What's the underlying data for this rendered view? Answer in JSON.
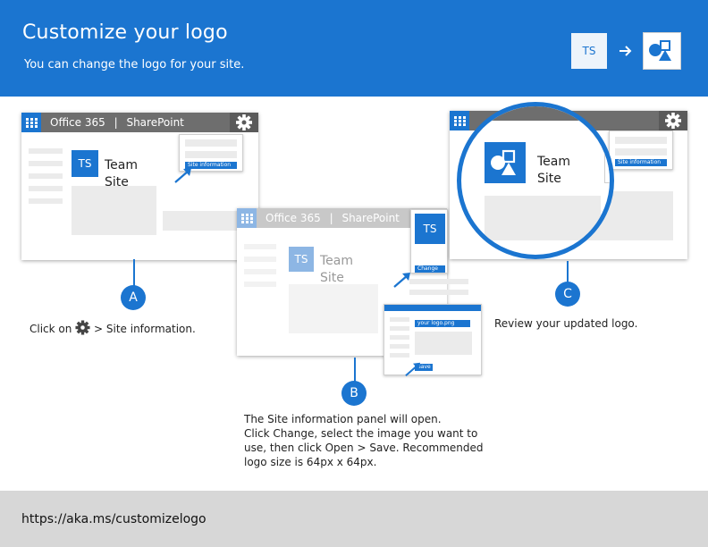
{
  "header": {
    "title": "Customize your logo",
    "subtitle": "You can change the logo for your site.",
    "initials": "TS",
    "accent": "#1b75d0"
  },
  "mock_a": {
    "bar_brand": "Office 365",
    "bar_separator": "|",
    "bar_product": "SharePoint",
    "initials": "TS",
    "site_line1": "Team",
    "site_line2": "Site",
    "panel_button": "Site information"
  },
  "mock_b": {
    "bar_brand": "Office 365",
    "bar_separator": "|",
    "bar_product": "SharePoint",
    "initials": "TS",
    "panel_initials": "TS",
    "site_line1": "Team",
    "site_line2": "Site",
    "change_button": "Change",
    "file_bar": "your logo.png",
    "save_button": "Save"
  },
  "mock_c": {
    "site_line1": "Team",
    "site_line2": "Site",
    "panel_button": "Site information"
  },
  "steps": {
    "a": {
      "label": "A",
      "prefix": "Click on",
      "suffix": "> Site information."
    },
    "b": {
      "label": "B",
      "line1": "The Site information panel will open.",
      "line2": "Click Change, select the image you want to",
      "line3": "use, then click Open > Save. Recommended",
      "line4": "logo size is 64px x 64px."
    },
    "c": {
      "label": "C",
      "text": "Review your updated logo."
    }
  },
  "footer": {
    "url": "https://aka.ms/customizelogo"
  },
  "icons": [
    "arrow-right-icon",
    "logo-shapes-icon",
    "waffle-icon",
    "gear-icon",
    "pointer-arrow-icon"
  ]
}
